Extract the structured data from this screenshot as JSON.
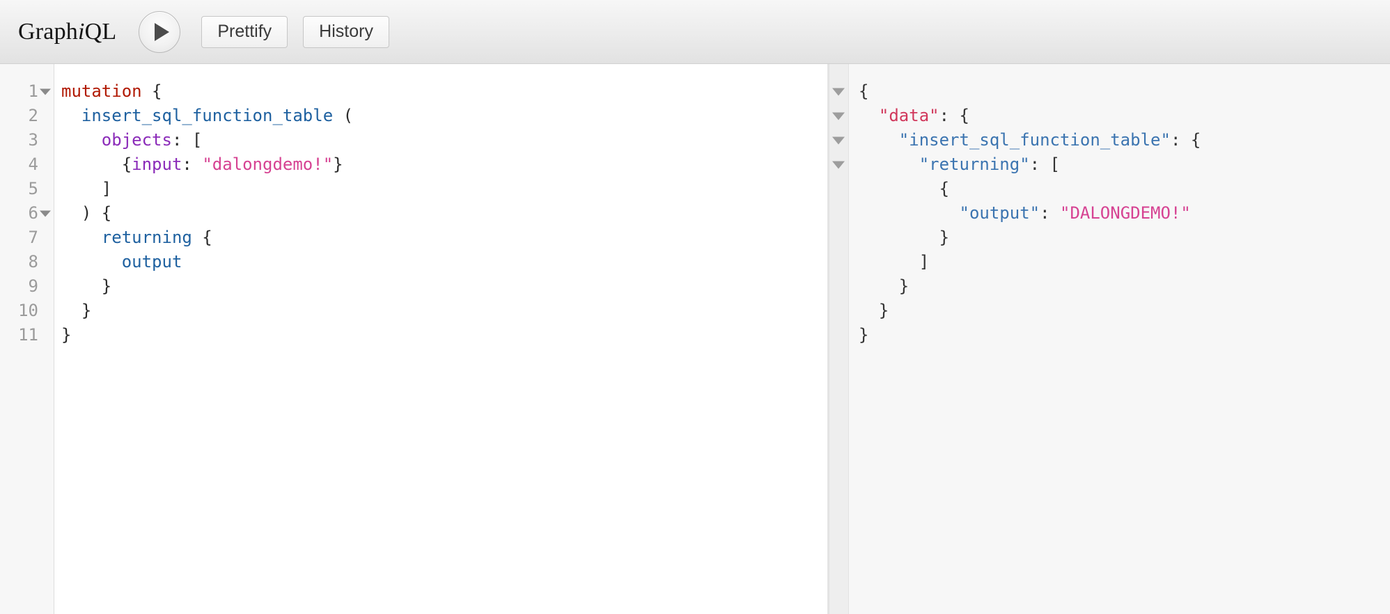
{
  "app": {
    "logo_pre": "Graph",
    "logo_i": "i",
    "logo_post": "QL"
  },
  "toolbar": {
    "execute_label": "",
    "execute_icon": "play-triangle-icon",
    "prettify_label": "Prettify",
    "history_label": "History"
  },
  "query_editor": {
    "line_numbers": [
      "1",
      "2",
      "3",
      "4",
      "5",
      "6",
      "7",
      "8",
      "9",
      "10",
      "11"
    ],
    "fold_lines": [
      "1",
      "6"
    ],
    "lines": [
      {
        "n": "1",
        "tokens": [
          {
            "t": "keyword",
            "s": "mutation"
          },
          {
            "t": "punct",
            "s": " {"
          }
        ]
      },
      {
        "n": "2",
        "tokens": [
          {
            "t": "punct",
            "s": "  "
          },
          {
            "t": "field",
            "s": "insert_sql_function_table"
          },
          {
            "t": "punct",
            "s": " ("
          }
        ]
      },
      {
        "n": "3",
        "tokens": [
          {
            "t": "punct",
            "s": "    "
          },
          {
            "t": "arg",
            "s": "objects"
          },
          {
            "t": "punct",
            "s": ": ["
          }
        ]
      },
      {
        "n": "4",
        "tokens": [
          {
            "t": "punct",
            "s": "      {"
          },
          {
            "t": "arg",
            "s": "input"
          },
          {
            "t": "punct",
            "s": ": "
          },
          {
            "t": "string",
            "s": "\"dalongdemo!\""
          },
          {
            "t": "punct",
            "s": "}"
          }
        ]
      },
      {
        "n": "5",
        "tokens": [
          {
            "t": "punct",
            "s": "    ]"
          }
        ]
      },
      {
        "n": "6",
        "tokens": [
          {
            "t": "punct",
            "s": "  ) {"
          }
        ]
      },
      {
        "n": "7",
        "tokens": [
          {
            "t": "punct",
            "s": "    "
          },
          {
            "t": "field",
            "s": "returning"
          },
          {
            "t": "punct",
            "s": " {"
          }
        ]
      },
      {
        "n": "8",
        "tokens": [
          {
            "t": "punct",
            "s": "      "
          },
          {
            "t": "field",
            "s": "output"
          }
        ]
      },
      {
        "n": "9",
        "tokens": [
          {
            "t": "punct",
            "s": "    }"
          }
        ]
      },
      {
        "n": "10",
        "tokens": [
          {
            "t": "punct",
            "s": "  }"
          }
        ]
      },
      {
        "n": "11",
        "tokens": [
          {
            "t": "punct",
            "s": "}"
          }
        ]
      }
    ],
    "plain_text": "mutation {\n  insert_sql_function_table (\n    objects: [\n      {input: \"dalongdemo!\"}\n    ]\n  ) {\n    returning {\n      output\n    }\n  }\n}"
  },
  "result_viewer": {
    "fold_count": 4,
    "lines": [
      {
        "fold": true,
        "tokens": [
          {
            "t": "brace",
            "s": "{"
          }
        ]
      },
      {
        "fold": true,
        "tokens": [
          {
            "t": "punct",
            "s": "  "
          },
          {
            "t": "key-red",
            "s": "\"data\""
          },
          {
            "t": "brace",
            "s": ": {"
          }
        ]
      },
      {
        "fold": true,
        "tokens": [
          {
            "t": "punct",
            "s": "    "
          },
          {
            "t": "key-blue",
            "s": "\"insert_sql_function_table\""
          },
          {
            "t": "brace",
            "s": ": {"
          }
        ]
      },
      {
        "fold": true,
        "tokens": [
          {
            "t": "punct",
            "s": "      "
          },
          {
            "t": "key-blue",
            "s": "\"returning\""
          },
          {
            "t": "brace",
            "s": ": ["
          }
        ]
      },
      {
        "fold": false,
        "tokens": [
          {
            "t": "brace",
            "s": "        {"
          }
        ]
      },
      {
        "fold": false,
        "tokens": [
          {
            "t": "punct",
            "s": "          "
          },
          {
            "t": "key-blue",
            "s": "\"output\""
          },
          {
            "t": "brace",
            "s": ": "
          },
          {
            "t": "string",
            "s": "\"DALONGDEMO!\""
          }
        ]
      },
      {
        "fold": false,
        "tokens": [
          {
            "t": "brace",
            "s": "        }"
          }
        ]
      },
      {
        "fold": false,
        "tokens": [
          {
            "t": "brace",
            "s": "      ]"
          }
        ]
      },
      {
        "fold": false,
        "tokens": [
          {
            "t": "brace",
            "s": "    }"
          }
        ]
      },
      {
        "fold": false,
        "tokens": [
          {
            "t": "brace",
            "s": "  }"
          }
        ]
      },
      {
        "fold": false,
        "tokens": [
          {
            "t": "brace",
            "s": "}"
          }
        ]
      }
    ],
    "plain_text": "{\n  \"data\": {\n    \"insert_sql_function_table\": {\n      \"returning\": [\n        {\n          \"output\": \"DALONGDEMO!\"\n        }\n      ]\n    }\n  }\n}",
    "output_value": "DALONGDEMO!"
  },
  "colors": {
    "keyword": "#b11a04",
    "field": "#1f61a0",
    "argument": "#8b2bb9",
    "string": "#d64292",
    "json_key_data": "#d1385c",
    "json_key": "#3b74b0",
    "toolbar_bg": "#e9e9e9",
    "result_bg": "#f7f7f7"
  }
}
